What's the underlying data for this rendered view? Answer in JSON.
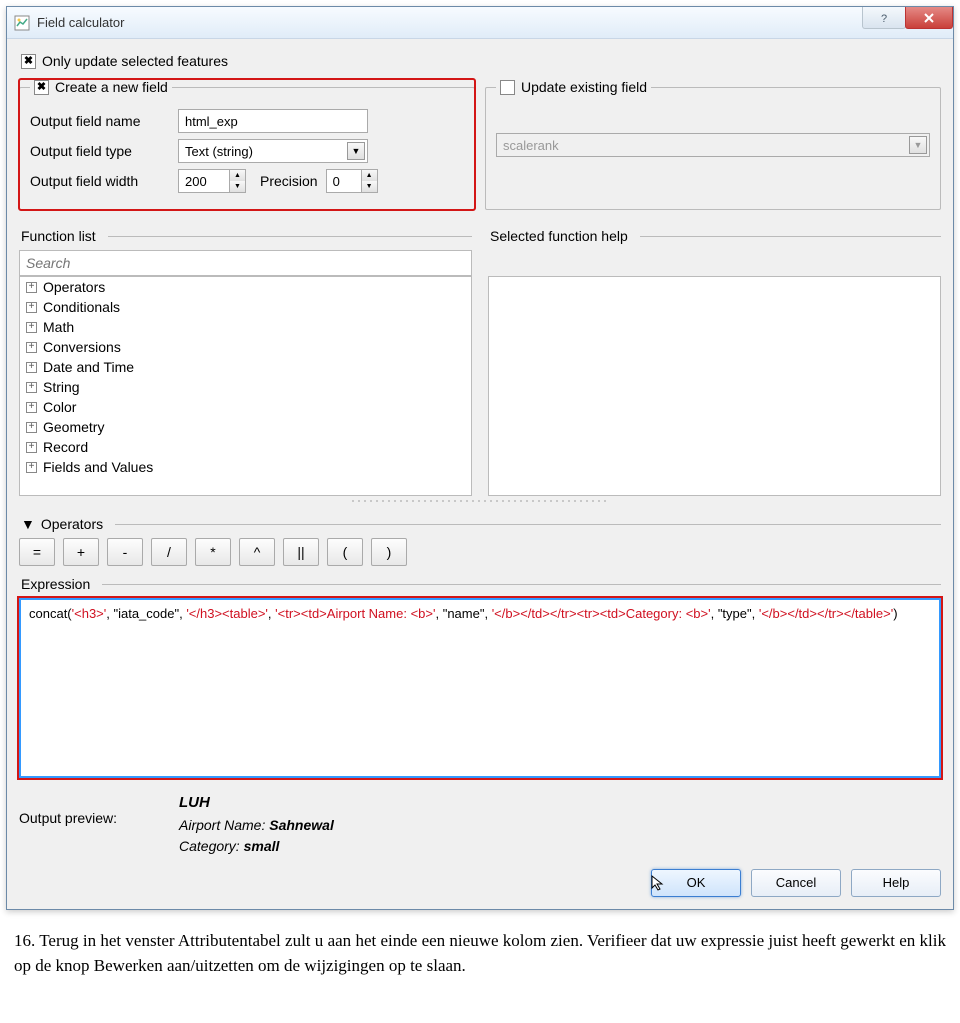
{
  "window": {
    "title": "Field calculator"
  },
  "only_update": {
    "label": "Only update selected features",
    "checked": true
  },
  "create_group": {
    "title": "Create a new field",
    "checked": true,
    "name_label": "Output field name",
    "name_value": "html_exp",
    "type_label": "Output field type",
    "type_value": "Text (string)",
    "width_label": "Output field width",
    "width_value": "200",
    "precision_label": "Precision",
    "precision_value": "0"
  },
  "update_group": {
    "title": "Update existing field",
    "checked": false,
    "field_value": "scalerank"
  },
  "function_list": {
    "title": "Function list",
    "search_placeholder": "Search",
    "items": [
      "Operators",
      "Conditionals",
      "Math",
      "Conversions",
      "Date and Time",
      "String",
      "Color",
      "Geometry",
      "Record",
      "Fields and Values"
    ]
  },
  "help": {
    "title": "Selected function help"
  },
  "operators": {
    "title": "Operators",
    "buttons": [
      "=",
      "+",
      "-",
      "/",
      "*",
      "^",
      "||",
      "(",
      ")"
    ]
  },
  "expression": {
    "title": "Expression",
    "text_parts": [
      {
        "t": "concat(",
        "c": "plain"
      },
      {
        "t": "'<h3>'",
        "c": "red"
      },
      {
        "t": ", \"iata_code\", ",
        "c": "plain"
      },
      {
        "t": "'</h3><table>'",
        "c": "red"
      },
      {
        "t": ", ",
        "c": "plain"
      },
      {
        "t": "'<tr><td>Airport Name: <b>'",
        "c": "red"
      },
      {
        "t": ", \"name\", ",
        "c": "plain"
      },
      {
        "t": "'</b></td></tr><tr><td>Category: <b>'",
        "c": "red"
      },
      {
        "t": ", \"type\", ",
        "c": "plain"
      },
      {
        "t": "'</b></td></tr></table>'",
        "c": "red"
      },
      {
        "t": ")",
        "c": "plain"
      }
    ]
  },
  "preview": {
    "label": "Output preview:",
    "heading": "LUH",
    "line1_label": "Airport Name: ",
    "line1_value": "Sahnewal",
    "line2_label": "Category: ",
    "line2_value": "small"
  },
  "buttons": {
    "ok": "OK",
    "cancel": "Cancel",
    "help": "Help"
  },
  "doc": {
    "number": "16.",
    "text": "Terug in het venster Attributentabel zult u aan het einde een nieuwe kolom zien. Verifieer dat uw expressie juist heeft gewerkt en klik op de knop Bewerken aan/uitzetten om de wijzigingen op te slaan."
  }
}
